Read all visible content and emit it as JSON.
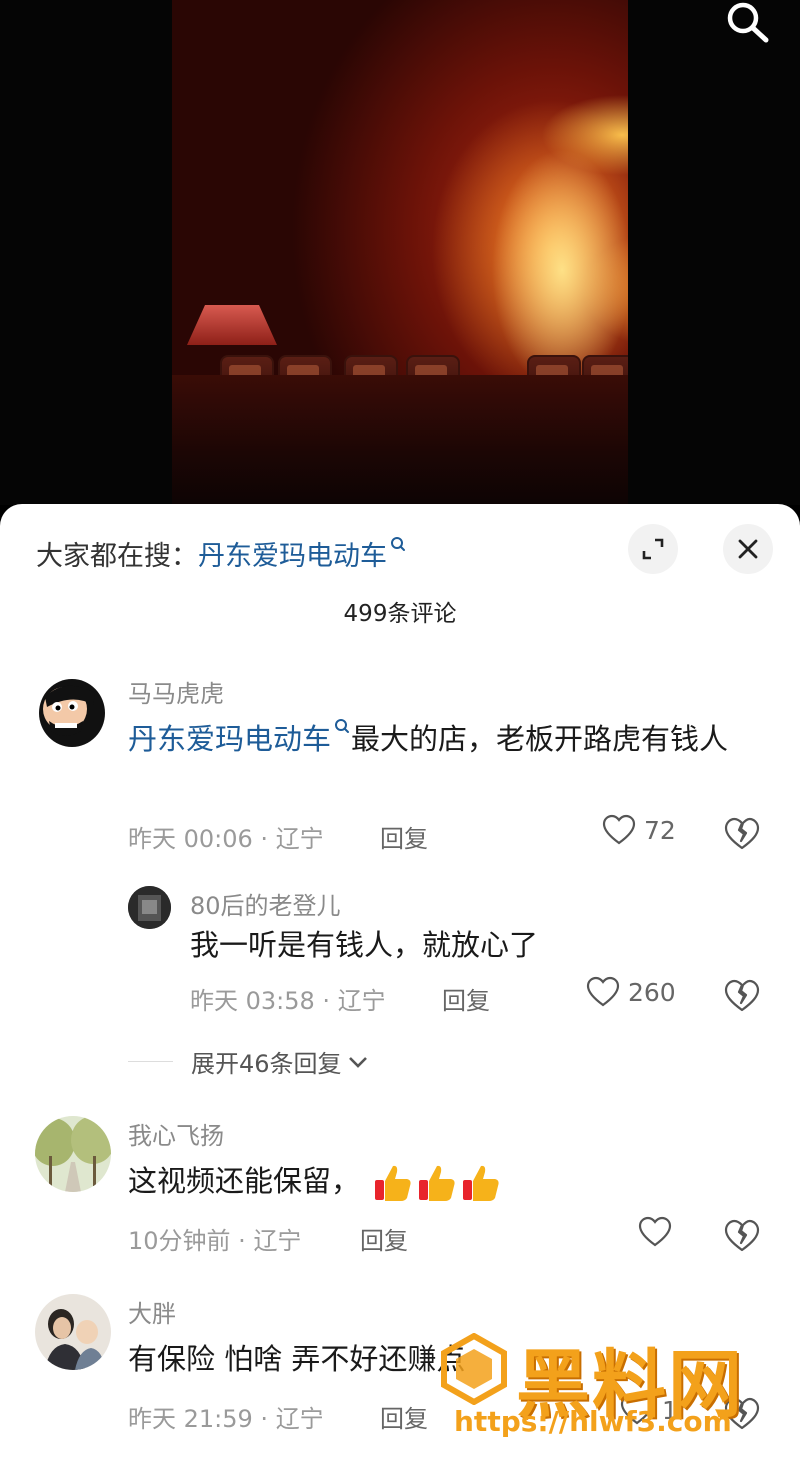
{
  "hot_search": {
    "prefix": "大家都在搜：",
    "keyword": "丹东爱玛电动车"
  },
  "comment_count": "499条评论",
  "comments": [
    {
      "user": "马马虎虎",
      "keyword": "丹东爱玛电动车",
      "text": "最大的店，老板开路虎有钱人",
      "time": "昨天 00:06",
      "region": "辽宁",
      "reply_label": "回复",
      "likes": "72",
      "replies": [
        {
          "user": "80后的老登儿",
          "text": "我一听是有钱人，就放心了",
          "time": "昨天 03:58",
          "region": "辽宁",
          "reply_label": "回复",
          "likes": "260"
        }
      ],
      "expand_label": "展开46条回复"
    },
    {
      "user": "我心飞扬",
      "text": "这视频还能保留，",
      "time": "10分钟前",
      "region": "辽宁",
      "reply_label": "回复",
      "likes": ""
    },
    {
      "user": "大胖",
      "text": "有保险 怕啥 弄不好还赚点",
      "time": "昨天 21:59",
      "region": "辽宁",
      "reply_label": "回复",
      "likes": "1"
    }
  ],
  "watermark": {
    "title": "黑料网",
    "url": "https://hlwf3.com"
  },
  "colors": {
    "keyword": "#1e5c98",
    "watermark": "#f3a11b"
  }
}
